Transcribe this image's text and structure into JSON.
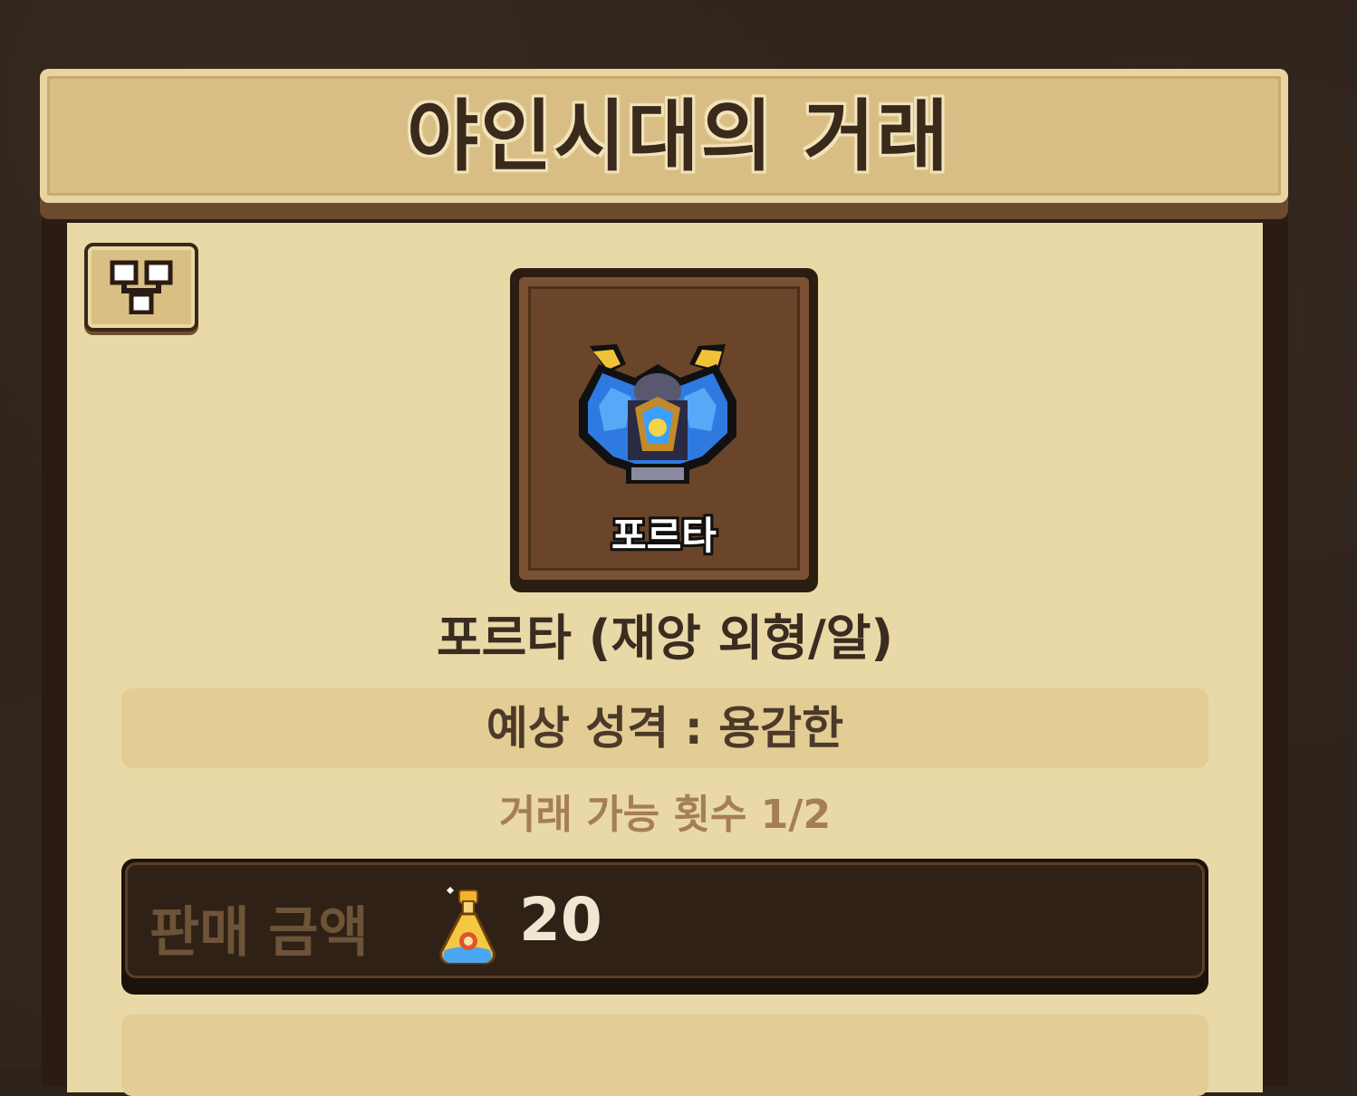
{
  "header": {
    "title": "야인시대의 거래"
  },
  "portrait": {
    "name": "포르타"
  },
  "item": {
    "title": "포르타 (재앙 외형/알)"
  },
  "temperament": {
    "text": "예상 성격 : 용감한"
  },
  "trade": {
    "count_text": "거래 가능 횟수 1/2"
  },
  "price": {
    "label": "판매 금액",
    "value": "20",
    "currency_icon": "potion-icon"
  },
  "icons": {
    "tree_button": "tree-icon"
  },
  "colors": {
    "panel": "#e9d9a6",
    "header": "#d8be84",
    "dark": "#2a1c12"
  }
}
